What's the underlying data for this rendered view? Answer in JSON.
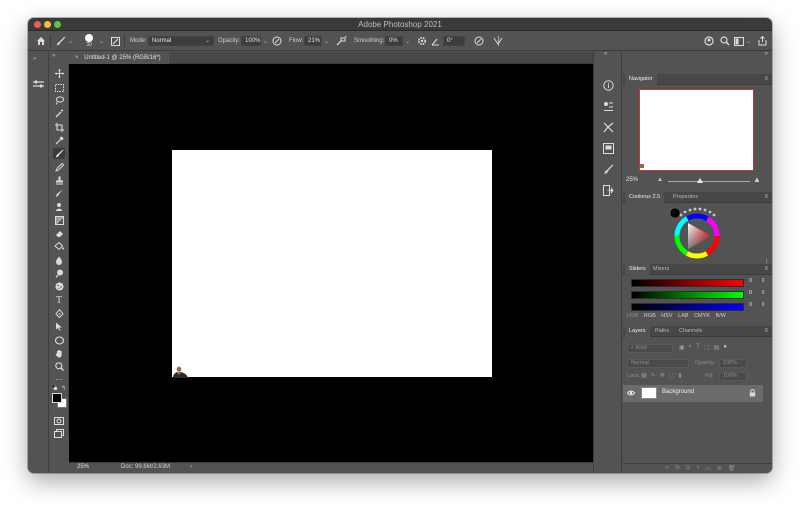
{
  "app": {
    "title": "Adobe Photoshop 2021"
  },
  "options": {
    "brush_size": "30",
    "mode_label": "Mode:",
    "mode_value": "Normal",
    "opacity_label": "Opacity:",
    "opacity_value": "100%",
    "flow_label": "Flow:",
    "flow_value": "21%",
    "smoothing_label": "Smoothing:",
    "smoothing_value": "0%",
    "angle_value": "0°"
  },
  "document": {
    "tab_title": "Untitled-1 @ 25% (RGB/16*)",
    "zoom": "25%",
    "doc_info": "Doc: 99.6M/2.63M"
  },
  "navigator": {
    "tab": "Navigator",
    "zoom": "25%"
  },
  "color_panel": {
    "tabs": [
      "Coolorus 2.5",
      "Properties"
    ]
  },
  "sliders_panel": {
    "tabs": [
      "Sliders",
      "Mixers"
    ],
    "channels": [
      {
        "value": "0",
        "color": "#ff0000"
      },
      {
        "value": "0",
        "color": "#00ff00"
      },
      {
        "value": "0",
        "color": "#0000ff"
      }
    ],
    "modes": [
      "HSB",
      "RGB",
      "HSV",
      "LAB",
      "CMYK",
      "B/W"
    ]
  },
  "layers": {
    "tabs": [
      "Layers",
      "Paths",
      "Channels"
    ],
    "kind_placeholder": "Kind",
    "blend_mode": "Normal",
    "opacity_label": "Opacity:",
    "opacity_value": "100%",
    "lock_label": "Lock:",
    "fill_label": "Fill:",
    "fill_value": "100%",
    "items": [
      {
        "name": "Background"
      }
    ]
  },
  "colors": {
    "foreground": "#000000",
    "background": "#ffffff",
    "accent": "#c23a3a"
  }
}
